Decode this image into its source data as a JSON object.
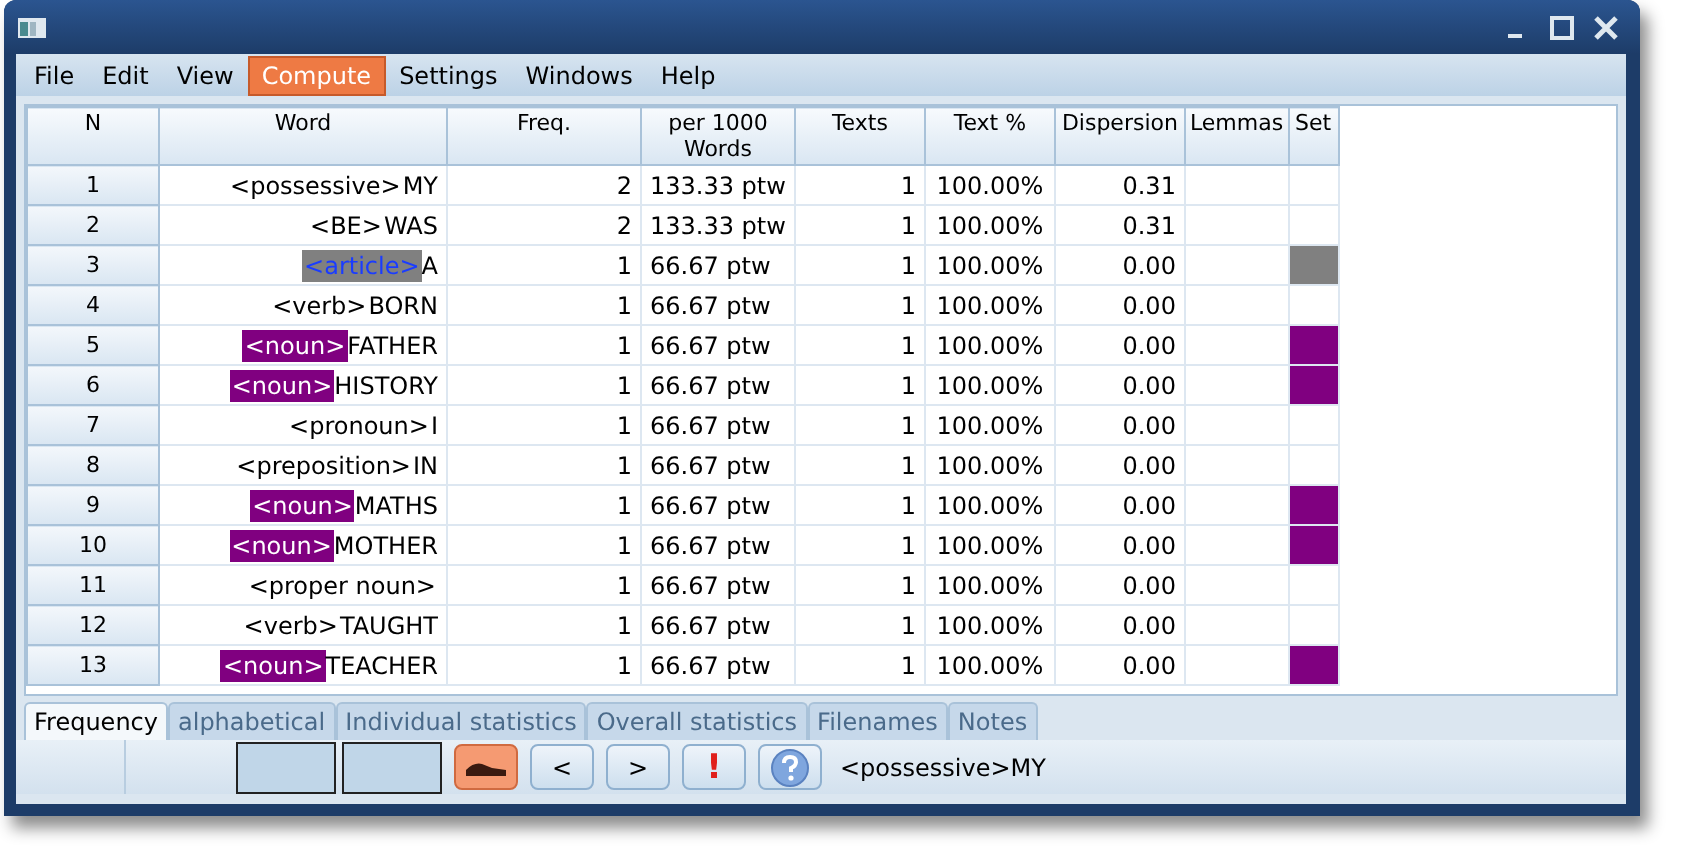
{
  "menu": [
    {
      "label": "File",
      "selected": false
    },
    {
      "label": "Edit",
      "selected": false
    },
    {
      "label": "View",
      "selected": false
    },
    {
      "label": "Compute",
      "selected": true
    },
    {
      "label": "Settings",
      "selected": false
    },
    {
      "label": "Windows",
      "selected": false
    },
    {
      "label": "Help",
      "selected": false
    }
  ],
  "table": {
    "columns": [
      "N",
      "Word",
      "Freq.",
      "per 1000 Words",
      "Texts",
      "Text %",
      "Dispersion",
      "Lemmas",
      "Set"
    ],
    "rows": [
      {
        "n": "1",
        "tag": {
          "text": "<possessive>"
        },
        "word": "MY",
        "freq": "2",
        "per1000": "133.33 ptw",
        "texts": "1",
        "text_pct": "100.00%",
        "dispersion": "0.31"
      },
      {
        "n": "2",
        "tag": {
          "text": "<BE>"
        },
        "word": "WAS",
        "freq": "2",
        "per1000": "133.33 ptw",
        "texts": "1",
        "text_pct": "100.00%",
        "dispersion": "0.31"
      },
      {
        "n": "3",
        "tag": {
          "text": "<article>",
          "color": "#808080"
        },
        "word": "A",
        "freq": "1",
        "per1000": "66.67 ptw",
        "texts": "1",
        "text_pct": "100.00%",
        "dispersion": "0.00",
        "set": {
          "color": "#808080"
        }
      },
      {
        "n": "4",
        "tag": {
          "text": "<verb>"
        },
        "word": "BORN",
        "freq": "1",
        "per1000": "66.67 ptw",
        "texts": "1",
        "text_pct": "100.00%",
        "dispersion": "0.00"
      },
      {
        "n": "5",
        "tag": {
          "text": "<noun>",
          "color": "#800080"
        },
        "word": "FATHER",
        "freq": "1",
        "per1000": "66.67 ptw",
        "texts": "1",
        "text_pct": "100.00%",
        "dispersion": "0.00",
        "set": {
          "color": "#800080"
        }
      },
      {
        "n": "6",
        "tag": {
          "text": "<noun>",
          "color": "#800080"
        },
        "word": "HISTORY",
        "freq": "1",
        "per1000": "66.67 ptw",
        "texts": "1",
        "text_pct": "100.00%",
        "dispersion": "0.00",
        "set": {
          "color": "#800080"
        }
      },
      {
        "n": "7",
        "tag": {
          "text": "<pronoun>"
        },
        "word": "I",
        "freq": "1",
        "per1000": "66.67 ptw",
        "texts": "1",
        "text_pct": "100.00%",
        "dispersion": "0.00"
      },
      {
        "n": "8",
        "tag": {
          "text": "<preposition>"
        },
        "word": "IN",
        "freq": "1",
        "per1000": "66.67 ptw",
        "texts": "1",
        "text_pct": "100.00%",
        "dispersion": "0.00"
      },
      {
        "n": "9",
        "tag": {
          "text": "<noun>",
          "color": "#800080"
        },
        "word": "MATHS",
        "freq": "1",
        "per1000": "66.67 ptw",
        "texts": "1",
        "text_pct": "100.00%",
        "dispersion": "0.00",
        "set": {
          "color": "#800080"
        }
      },
      {
        "n": "10",
        "tag": {
          "text": "<noun>",
          "color": "#800080"
        },
        "word": "MOTHER",
        "freq": "1",
        "per1000": "66.67 ptw",
        "texts": "1",
        "text_pct": "100.00%",
        "dispersion": "0.00",
        "set": {
          "color": "#800080"
        }
      },
      {
        "n": "11",
        "tag": {
          "text": "<proper noun>"
        },
        "freq": "1",
        "per1000": "66.67 ptw",
        "texts": "1",
        "text_pct": "100.00%",
        "dispersion": "0.00"
      },
      {
        "n": "12",
        "tag": {
          "text": "<verb>"
        },
        "word": "TAUGHT",
        "freq": "1",
        "per1000": "66.67 ptw",
        "texts": "1",
        "text_pct": "100.00%",
        "dispersion": "0.00"
      },
      {
        "n": "13",
        "tag": {
          "text": "<noun>",
          "color": "#800080"
        },
        "word": "TEACHER",
        "freq": "1",
        "per1000": "66.67 ptw",
        "texts": "1",
        "text_pct": "100.00%",
        "dispersion": "0.00",
        "set": {
          "color": "#800080"
        }
      }
    ]
  },
  "tabs": [
    {
      "label": "Frequency",
      "selected": true
    },
    {
      "label": "alphabetical",
      "selected": false
    },
    {
      "label": "Individual statistics",
      "selected": false
    },
    {
      "label": "Overall statistics",
      "selected": false
    },
    {
      "label": "Filenames",
      "selected": false
    },
    {
      "label": "Notes",
      "selected": false
    }
  ],
  "status_bar": {
    "buttons": [
      {
        "kind": "shoe"
      },
      {
        "kind": "text",
        "label": "<"
      },
      {
        "kind": "text",
        "label": ">"
      },
      {
        "kind": "alert",
        "label": "!"
      },
      {
        "kind": "help"
      }
    ],
    "text": "<possessive>MY"
  }
}
